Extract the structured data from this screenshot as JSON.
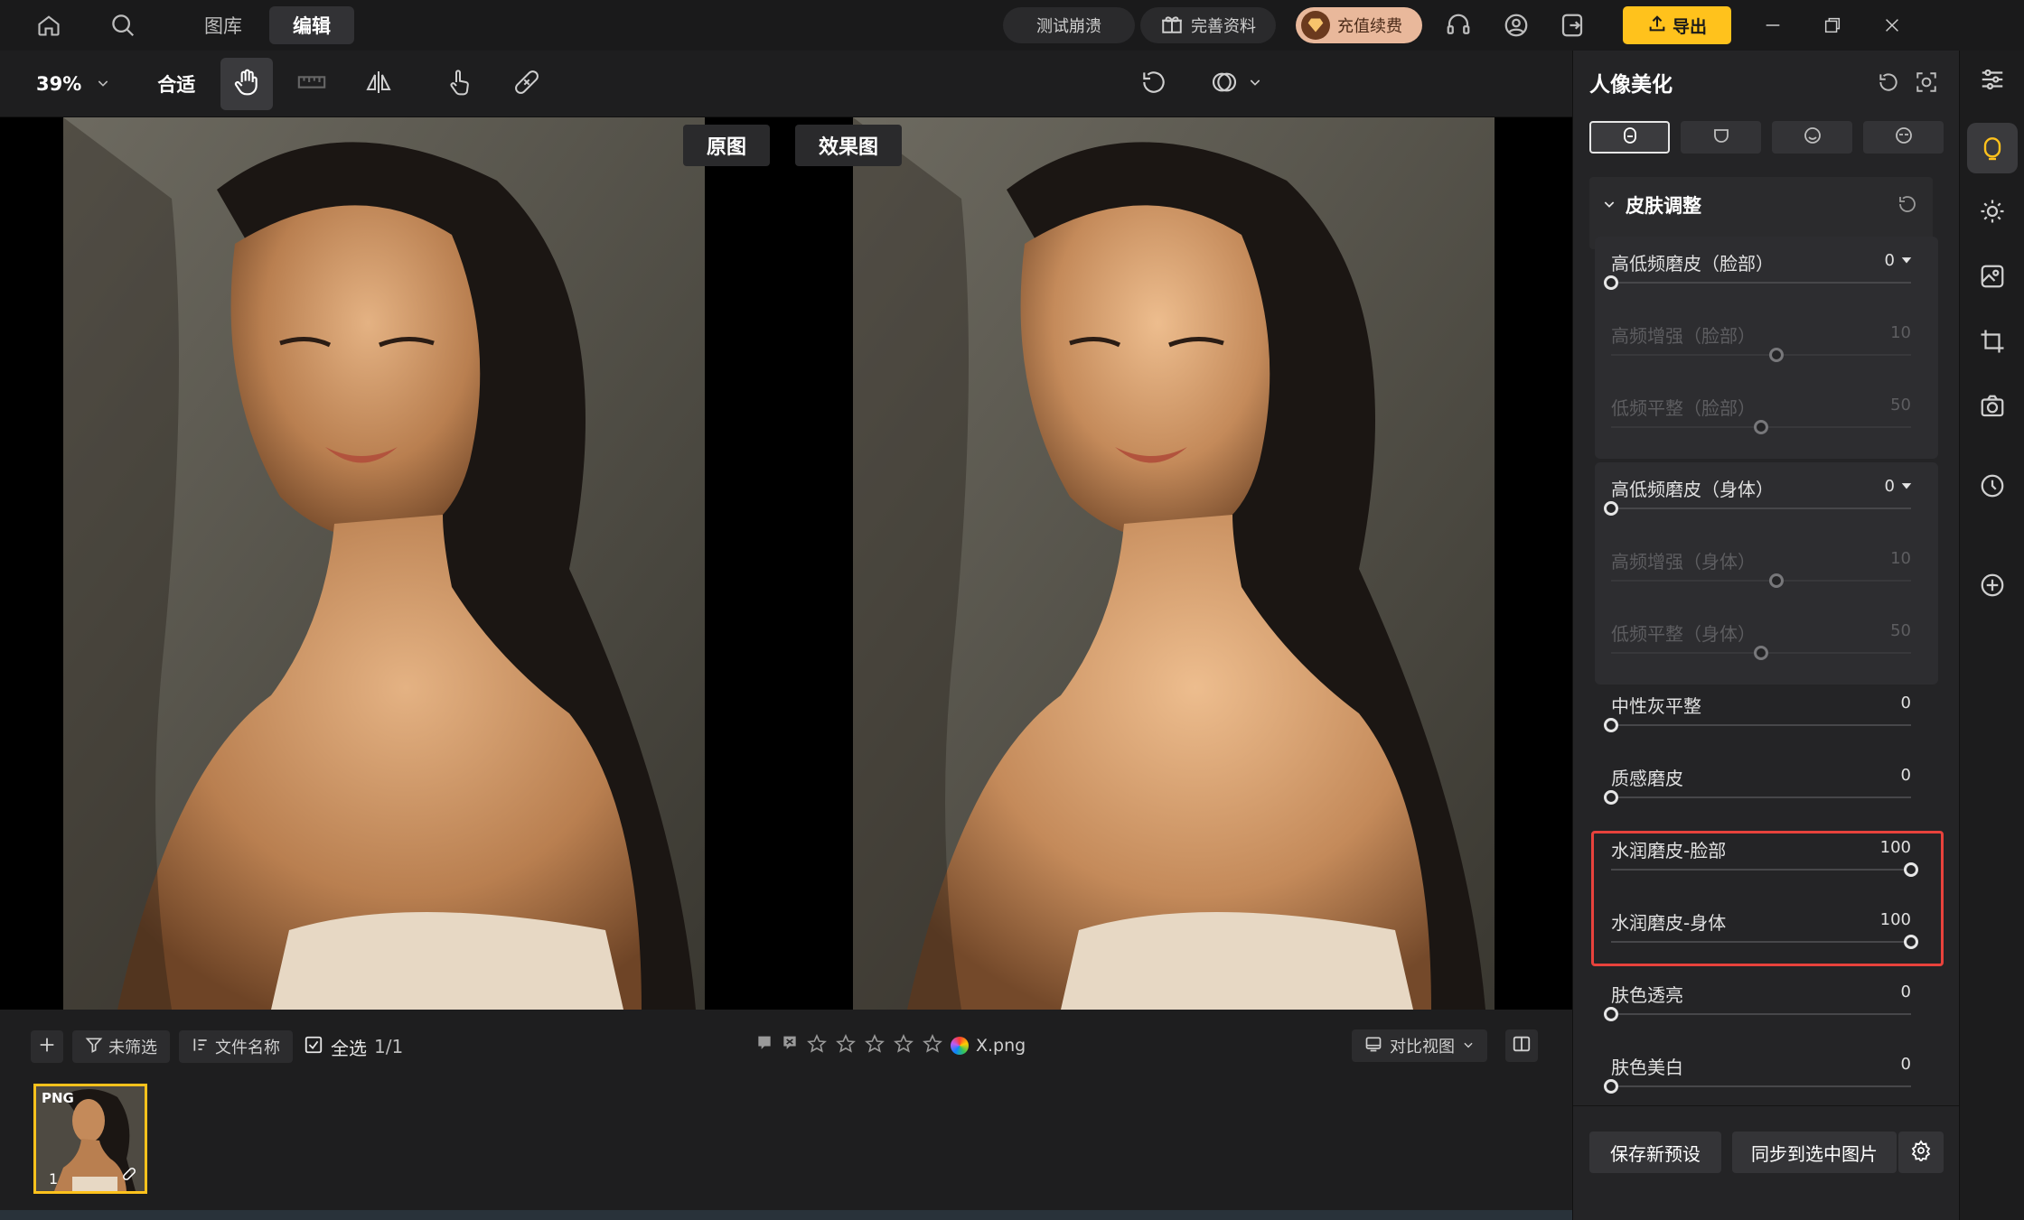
{
  "topbar": {
    "tabs": [
      {
        "label": "图库"
      },
      {
        "label": "编辑"
      }
    ],
    "report_label": "测试崩溃",
    "profile_label": "完善资料",
    "vip_label": "充值续费",
    "export_label": "导出"
  },
  "toolbar": {
    "zoom": "39%",
    "fit_label": "合适"
  },
  "canvas": {
    "before_label": "原图",
    "after_label": "效果图"
  },
  "bottombar": {
    "filter_label": "未筛选",
    "sort_label": "文件名称",
    "select_all_label": "全选",
    "select_count": "1/1",
    "filename": "X.png",
    "view_mode_label": "对比视图"
  },
  "filmstrip": {
    "thumb_tag": "PNG",
    "thumb_index": "1"
  },
  "panel": {
    "title": "人像美化",
    "section_title": "皮肤调整",
    "sliders": [
      {
        "label": "高低频磨皮（脸部）",
        "value": "0",
        "level": 0
      },
      {
        "label": "高频增强（脸部）",
        "value": "10",
        "level": 0.55
      },
      {
        "label": "低频平整（脸部）",
        "value": "50",
        "level": 0.5
      },
      {
        "label": "高低频磨皮（身体）",
        "value": "0",
        "level": 0
      },
      {
        "label": "高频增强（身体）",
        "value": "10",
        "level": 0.55
      },
      {
        "label": "低频平整（身体）",
        "value": "50",
        "level": 0.5
      },
      {
        "label": "中性灰平整",
        "value": "0",
        "level": 0
      },
      {
        "label": "质感磨皮",
        "value": "0",
        "level": 0
      },
      {
        "label": "水润磨皮-脸部",
        "value": "100",
        "level": 1
      },
      {
        "label": "水润磨皮-身体",
        "value": "100",
        "level": 1
      },
      {
        "label": "肤色透亮",
        "value": "0",
        "level": 0
      },
      {
        "label": "肤色美白",
        "value": "0",
        "level": 0
      }
    ],
    "save_preset_label": "保存新预设",
    "sync_label": "同步到选中图片"
  },
  "colors": {
    "accent": "#ffc21c",
    "highlight": "#e8423c"
  }
}
